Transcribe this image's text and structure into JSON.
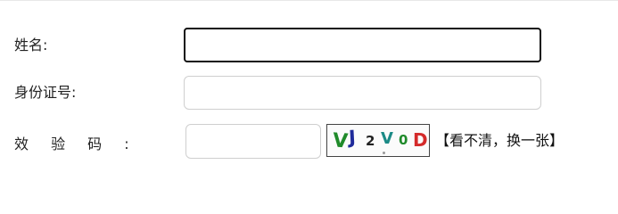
{
  "form": {
    "name_label": "姓名:",
    "id_label": "身份证号:",
    "code_label": "效 验 码 :",
    "name_value": "",
    "id_value": "",
    "code_value": ""
  },
  "captcha": {
    "chars": [
      {
        "char": "V",
        "color": "#1f8a2a"
      },
      {
        "char": "J",
        "color": "#1e2a9a"
      },
      {
        "char": "2",
        "color": "#222222"
      },
      {
        "char": "V",
        "color": "#1b8a86"
      },
      {
        "char": "0",
        "color": "#1f8a2a"
      },
      {
        "char": "D",
        "color": "#d42a2a"
      }
    ]
  },
  "refresh_link": "【看不清，换一张】"
}
